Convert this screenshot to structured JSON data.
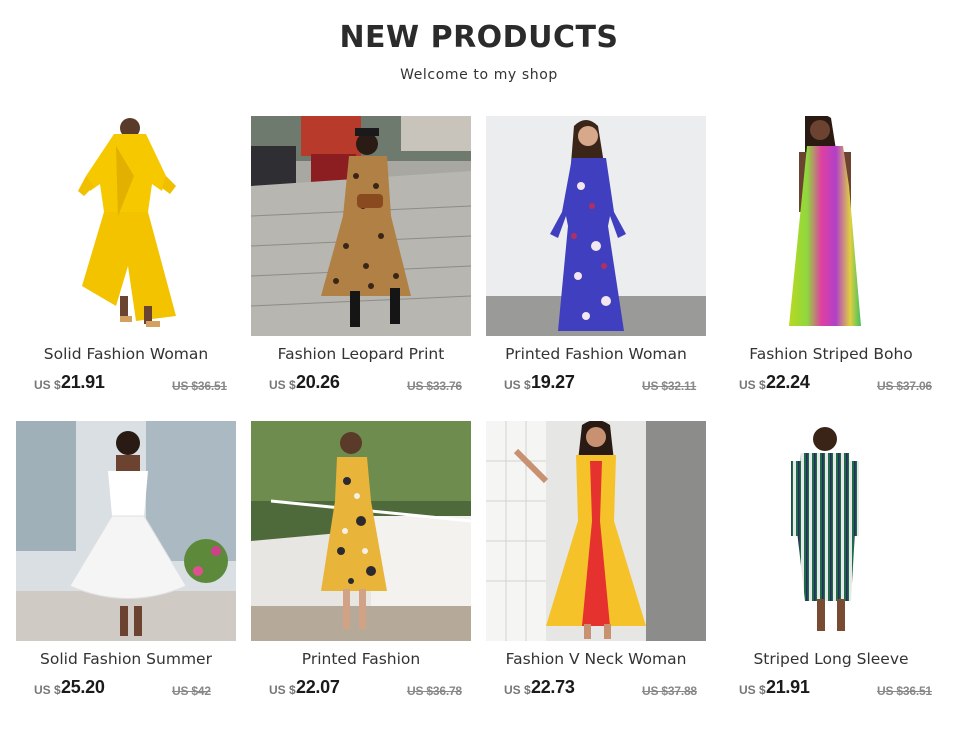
{
  "header": {
    "title": "NEW PRODUCTS",
    "subtitle": "Welcome to my shop"
  },
  "products": [
    {
      "name": "Solid Fashion Woman",
      "currency": "US $",
      "price": "21.91",
      "old_price": "US $36.51",
      "image": "yellow-ruffle-maxi-dress"
    },
    {
      "name": "Fashion Leopard Print",
      "currency": "US $",
      "price": "20.26",
      "old_price": "US $33.76",
      "image": "leopard-print-maxi-dress"
    },
    {
      "name": "Printed Fashion Woman",
      "currency": "US $",
      "price": "19.27",
      "old_price": "US $32.11",
      "image": "blue-floral-maxi-dress"
    },
    {
      "name": "Fashion Striped Boho",
      "currency": "US $",
      "price": "22.24",
      "old_price": "US $37.06",
      "image": "rainbow-striped-boho-dress"
    },
    {
      "name": "Solid Fashion Summer",
      "currency": "US $",
      "price": "25.20",
      "old_price": "US $42",
      "image": "white-tulle-dress"
    },
    {
      "name": "Printed Fashion",
      "currency": "US $",
      "price": "22.07",
      "old_price": "US $36.78",
      "image": "yellow-floral-dress"
    },
    {
      "name": "Fashion V Neck Woman",
      "currency": "US $",
      "price": "22.73",
      "old_price": "US $37.88",
      "image": "yellow-red-vneck-dress"
    },
    {
      "name": "Striped Long Sleeve",
      "currency": "US $",
      "price": "21.91",
      "old_price": "US $36.51",
      "image": "green-striped-shirt-dress"
    }
  ],
  "colors": {
    "title": "#2b2b2b",
    "price": "#1a1a1a",
    "old_price": "#888888"
  }
}
